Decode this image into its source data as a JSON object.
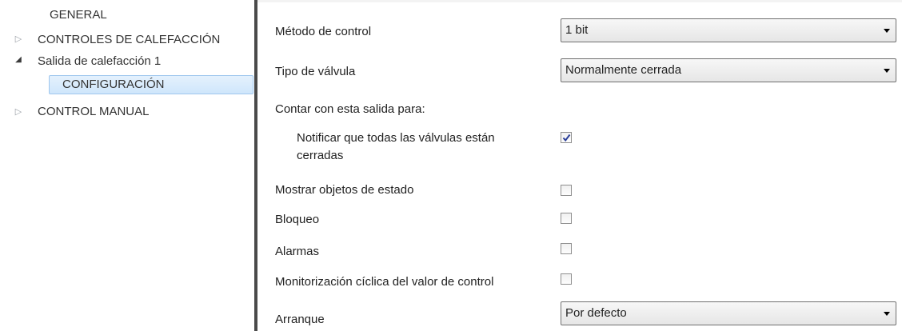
{
  "sidebar": {
    "items": [
      {
        "label": "GENERAL"
      },
      {
        "label": "CONTROLES DE CALEFACCIÓN"
      },
      {
        "label": "Salida de calefacción 1"
      },
      {
        "label": "CONFIGURACIÓN"
      },
      {
        "label": "CONTROL MANUAL"
      }
    ]
  },
  "form": {
    "control_method_label": "Método de control",
    "control_method_value": "1 bit",
    "valve_type_label": "Tipo de válvula",
    "valve_type_value": "Normalmente cerrada",
    "count_output_label": "Contar con esta salida para:",
    "notify_label_line1": "Notificar que todas las válvulas están",
    "notify_label_line2": "cerradas",
    "notify_checked": true,
    "status_objects_label": "Mostrar objetos de estado",
    "status_objects_checked": false,
    "lock_label": "Bloqueo",
    "lock_checked": false,
    "alarms_label": "Alarmas",
    "alarms_checked": false,
    "cyclic_monitor_label": "Monitorización cíclica del valor de control",
    "cyclic_monitor_checked": false,
    "startup_label": "Arranque",
    "startup_value": "Por defecto"
  },
  "colors": {
    "selection": "#cfe6fb",
    "divider": "#4a4a4a"
  }
}
